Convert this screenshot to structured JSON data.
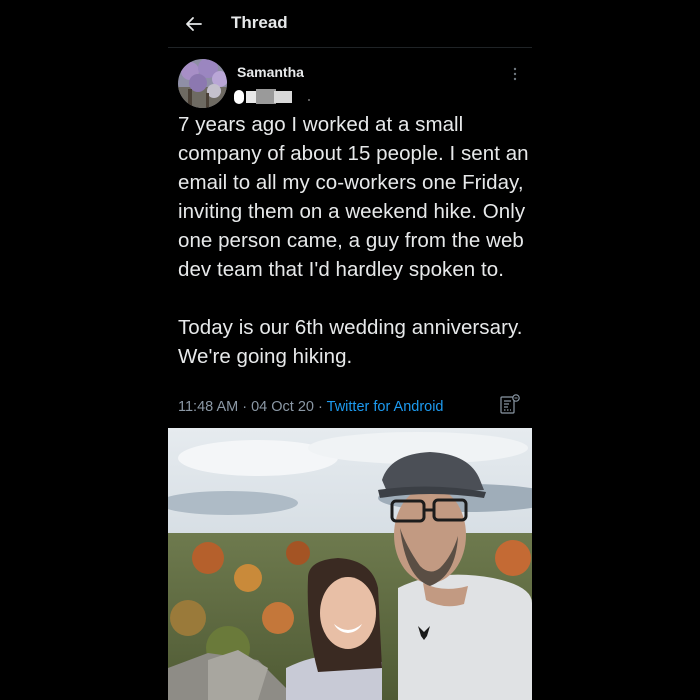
{
  "header": {
    "title": "Thread",
    "back_icon": "arrow-left-icon"
  },
  "tweet": {
    "author_name": "Samantha",
    "text": "7 years ago I worked at a small company of about 15 people. I sent an email to all my co-workers one Friday, inviting them on a weekend hike. Only one person came, a guy from the web dev team that I'd hardley spoken to.\n\nToday is our 6th wedding anniversary. We're going hiking.",
    "time": "11:48 AM",
    "separator": "·",
    "date": "04 Oct 20",
    "source": "Twitter for Android",
    "source_color": "#1d9bf0"
  },
  "colors": {
    "background": "#000000",
    "text_primary": "#e7e9ea",
    "text_secondary": "#8b98a5"
  }
}
